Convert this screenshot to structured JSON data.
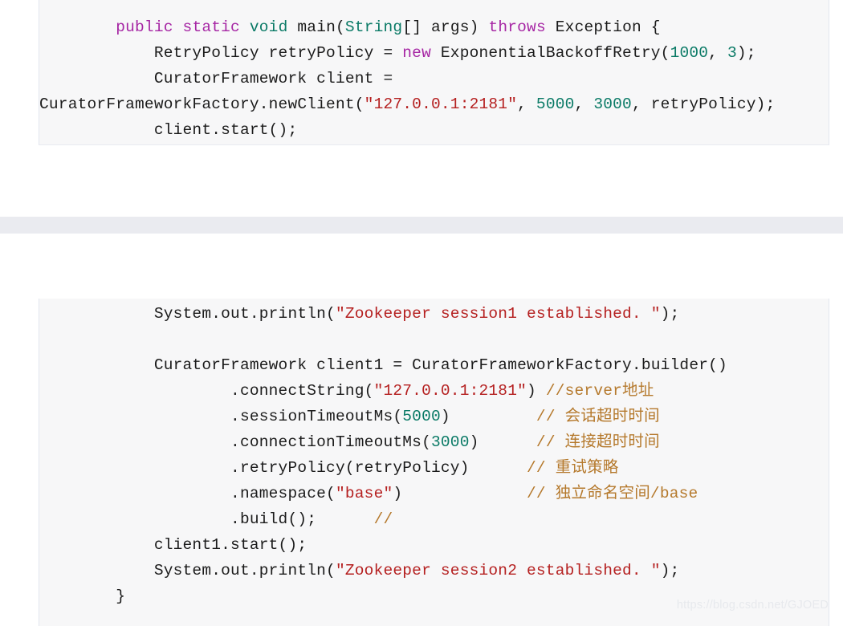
{
  "page": {
    "background_color": "#ffffff",
    "code_block_background": "#f7f7f8",
    "separator_band_color": "#eaebf0",
    "watermark": "https://blog.csdn.net/GJOED"
  },
  "syntax_colors": {
    "keyword": "#a626a4",
    "type": "#0a7a66",
    "number": "#0a7a66",
    "string": "#b52020",
    "comment": "#b5792c",
    "plain": "#1b1b1b"
  },
  "code_block_1": {
    "language": "java",
    "lines": [
      [
        {
          "t": "        ",
          "c": "pln"
        },
        {
          "t": "public",
          "c": "kw"
        },
        {
          "t": " ",
          "c": "pln"
        },
        {
          "t": "static",
          "c": "kw"
        },
        {
          "t": " ",
          "c": "pln"
        },
        {
          "t": "void",
          "c": "type"
        },
        {
          "t": " main(",
          "c": "pln"
        },
        {
          "t": "String",
          "c": "type"
        },
        {
          "t": "[] args) ",
          "c": "pln"
        },
        {
          "t": "throws",
          "c": "kw"
        },
        {
          "t": " Exception {",
          "c": "pln"
        }
      ],
      [
        {
          "t": "            RetryPolicy retryPolicy = ",
          "c": "pln"
        },
        {
          "t": "new",
          "c": "kw"
        },
        {
          "t": " ExponentialBackoffRetry(",
          "c": "pln"
        },
        {
          "t": "1000",
          "c": "num"
        },
        {
          "t": ", ",
          "c": "pln"
        },
        {
          "t": "3",
          "c": "num"
        },
        {
          "t": ");",
          "c": "pln"
        }
      ],
      [
        {
          "t": "            CuratorFramework client =",
          "c": "pln"
        }
      ],
      [
        {
          "t": "CuratorFrameworkFactory.newClient(",
          "c": "pln"
        },
        {
          "t": "\"127.0.0.1:2181\"",
          "c": "str"
        },
        {
          "t": ", ",
          "c": "pln"
        },
        {
          "t": "5000",
          "c": "num"
        },
        {
          "t": ", ",
          "c": "pln"
        },
        {
          "t": "3000",
          "c": "num"
        },
        {
          "t": ", retryPolicy);",
          "c": "pln"
        }
      ],
      [
        {
          "t": "            client.start();",
          "c": "pln"
        }
      ]
    ]
  },
  "code_block_2": {
    "language": "java",
    "lines": [
      [
        {
          "t": "            System.out.println(",
          "c": "pln"
        },
        {
          "t": "\"Zookeeper session1 established. \"",
          "c": "str"
        },
        {
          "t": ");",
          "c": "pln"
        }
      ],
      [
        {
          "t": "",
          "c": "pln"
        }
      ],
      [
        {
          "t": "            CuratorFramework client1 = CuratorFrameworkFactory.builder()",
          "c": "pln"
        }
      ],
      [
        {
          "t": "                    .connectString(",
          "c": "pln"
        },
        {
          "t": "\"127.0.0.1:2181\"",
          "c": "str"
        },
        {
          "t": ") ",
          "c": "pln"
        },
        {
          "t": "//server地址",
          "c": "cmt"
        }
      ],
      [
        {
          "t": "                    .sessionTimeoutMs(",
          "c": "pln"
        },
        {
          "t": "5000",
          "c": "num"
        },
        {
          "t": ")         ",
          "c": "pln"
        },
        {
          "t": "// 会话超时时间",
          "c": "cmt"
        }
      ],
      [
        {
          "t": "                    .connectionTimeoutMs(",
          "c": "pln"
        },
        {
          "t": "3000",
          "c": "num"
        },
        {
          "t": ")      ",
          "c": "pln"
        },
        {
          "t": "// 连接超时时间",
          "c": "cmt"
        }
      ],
      [
        {
          "t": "                    .retryPolicy(retryPolicy)      ",
          "c": "pln"
        },
        {
          "t": "// 重试策略",
          "c": "cmt"
        }
      ],
      [
        {
          "t": "                    .namespace(",
          "c": "pln"
        },
        {
          "t": "\"base\"",
          "c": "str"
        },
        {
          "t": ")             ",
          "c": "pln"
        },
        {
          "t": "// 独立命名空间/base",
          "c": "cmt"
        }
      ],
      [
        {
          "t": "                    .build();      ",
          "c": "pln"
        },
        {
          "t": "//",
          "c": "cmt"
        }
      ],
      [
        {
          "t": "            client1.start();",
          "c": "pln"
        }
      ],
      [
        {
          "t": "            System.out.println(",
          "c": "pln"
        },
        {
          "t": "\"Zookeeper session2 established. \"",
          "c": "str"
        },
        {
          "t": ");",
          "c": "pln"
        }
      ],
      [
        {
          "t": "        }",
          "c": "pln"
        }
      ]
    ]
  }
}
